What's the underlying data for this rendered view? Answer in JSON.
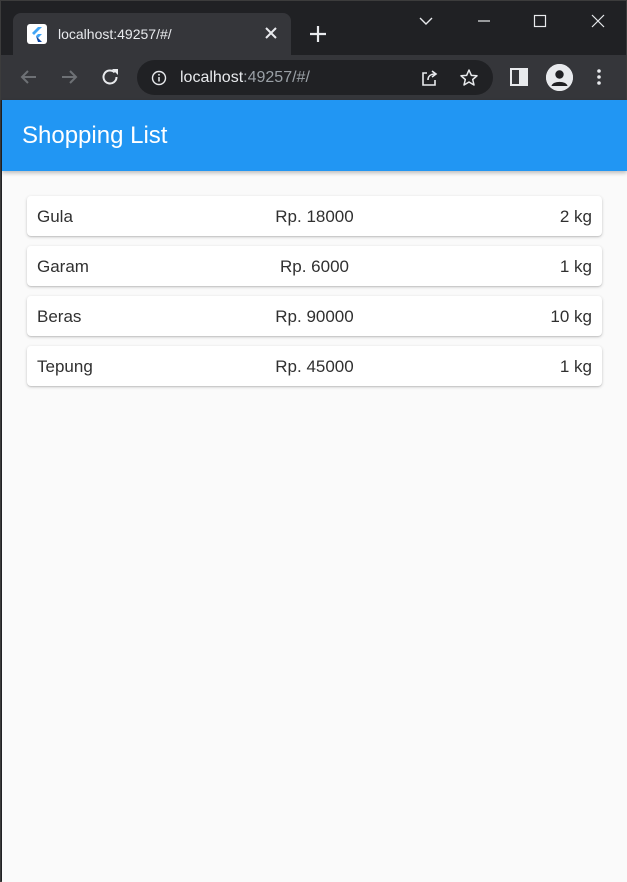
{
  "browser": {
    "tab_title": "localhost:49257/#/",
    "url_host": "localhost",
    "url_rest": ":49257/#/"
  },
  "app": {
    "title": "Shopping List",
    "accent_color": "#2196f3"
  },
  "items": [
    {
      "name": "Gula",
      "price": "Rp. 18000",
      "qty": "2 kg"
    },
    {
      "name": "Garam",
      "price": "Rp. 6000",
      "qty": "1 kg"
    },
    {
      "name": "Beras",
      "price": "Rp. 90000",
      "qty": "10 kg"
    },
    {
      "name": "Tepung",
      "price": "Rp. 45000",
      "qty": "1 kg"
    }
  ],
  "icons": {
    "favicon": "flutter-icon",
    "close": "close-icon",
    "new_tab": "plus-icon",
    "back": "back-arrow-icon",
    "forward": "forward-arrow-icon",
    "reload": "reload-icon",
    "info": "info-icon",
    "share": "share-icon",
    "bookmark": "star-icon",
    "side_panel": "side-panel-icon",
    "profile": "profile-icon",
    "menu": "kebab-menu-icon"
  }
}
